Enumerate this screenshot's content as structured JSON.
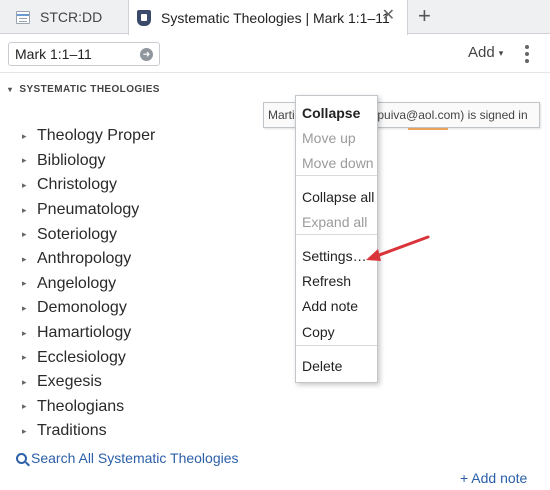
{
  "tabs": [
    {
      "label": "STCR:DD",
      "active": false
    },
    {
      "label": "Systematic Theologies | Mark 1:1–11",
      "active": true
    }
  ],
  "tab_close_glyph": "✕",
  "tab_add_glyph": "+",
  "toolbar": {
    "reference_value": "Mark 1:1–11",
    "add_label": "Add",
    "add_caret": "▾"
  },
  "section": {
    "title": "SYSTEMATIC THEOLOGIES",
    "expander": "▾"
  },
  "topics": [
    "Theology Proper",
    "Bibliology",
    "Christology",
    "Pneumatology",
    "Soteriology",
    "Anthropology",
    "Angelology",
    "Demonology",
    "Hamartiology",
    "Ecclesiology",
    "Exegesis",
    "Theologians",
    "Traditions"
  ],
  "topic_arrow": "▸",
  "tooltip": "Martin Espuiva (mespuiva@aol.com) is signed in",
  "search_all": "Search All Systematic Theologies",
  "add_note_link": "+ Add note",
  "context_menu": {
    "groups": [
      [
        {
          "label": "Collapse",
          "enabled": true,
          "bold": true
        },
        {
          "label": "Move up",
          "enabled": false,
          "bold": false
        },
        {
          "label": "Move down",
          "enabled": false,
          "bold": false
        }
      ],
      [
        {
          "label": "Collapse all",
          "enabled": true,
          "bold": false
        },
        {
          "label": "Expand all",
          "enabled": false,
          "bold": false
        }
      ],
      [
        {
          "label": "Settings…",
          "enabled": true,
          "bold": false
        },
        {
          "label": "Refresh",
          "enabled": true,
          "bold": false
        },
        {
          "label": "Add note",
          "enabled": true,
          "bold": false
        },
        {
          "label": "Copy",
          "enabled": true,
          "bold": false
        }
      ],
      [
        {
          "label": "Delete",
          "enabled": true,
          "bold": false
        }
      ]
    ]
  },
  "colors": {
    "link": "#2b5fa8",
    "annotation_arrow": "#d9343a",
    "disabled_text": "#9b9b9b"
  },
  "icons": [
    "document-icon",
    "shield-icon",
    "close-icon",
    "plus-icon",
    "arrow-circle-icon",
    "chevron-down-icon",
    "more-vertical-icon",
    "magnifier-icon",
    "mouse-pointer-icon",
    "red-annotation-arrow"
  ]
}
